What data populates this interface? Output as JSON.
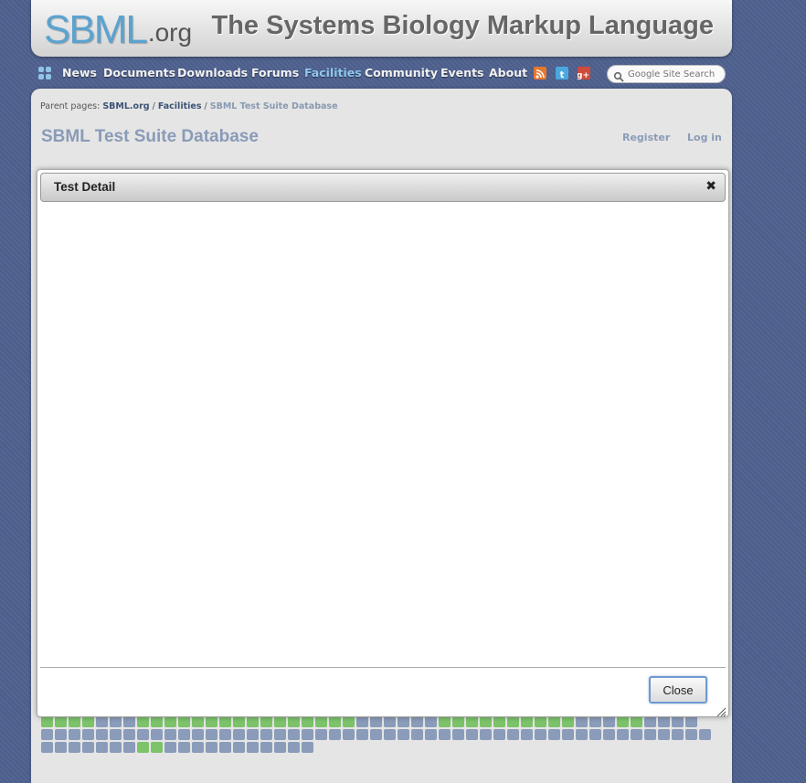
{
  "header": {
    "logo_mark": "SBML",
    "logo_suffix": ".org",
    "site_title": "The Systems Biology Markup Language"
  },
  "nav": {
    "home_icon": "sbml-home-icon",
    "items": [
      {
        "label": "News"
      },
      {
        "label": "Documents"
      },
      {
        "label": "Downloads"
      },
      {
        "label": "Forums"
      },
      {
        "label": "Facilities",
        "active": true
      },
      {
        "label": "Community"
      },
      {
        "label": "Events"
      },
      {
        "label": "About"
      }
    ],
    "social_icons": [
      "rss-icon",
      "twitter-icon",
      "google-plus-icon"
    ],
    "search": {
      "placeholder": "Google Site Search",
      "icon": "search-icon"
    }
  },
  "breadcrumb": {
    "prefix": "Parent pages:",
    "links": [
      "SBML.org",
      "Facilities"
    ],
    "current": "SBML Test Suite Database"
  },
  "page": {
    "title": "SBML Test Suite Database",
    "register_label": "Register",
    "login_label": "Log in"
  },
  "dialog": {
    "title": "Test Detail",
    "close_icon": "close-icon",
    "close_button_label": "Close",
    "resize_icon": "resize-grip-icon"
  },
  "result_grid": {
    "legend": {
      "pass": "green",
      "other": "gray"
    },
    "colors": {
      "pass": "#7cc36a",
      "other": "#8a9cba"
    },
    "rows": [
      "pppp444pppppppppppppppp888888pppppppppp333pp4444",
      "0000000000000000000000000000000000000000000000000",
      "0000000pp00000000000"
    ]
  },
  "colors": {
    "background": "#4d5f8c",
    "nav_active": "#8fc8ef",
    "title_color": "#8a9bb8",
    "rss": "#e8772e",
    "twitter": "#4aa8de",
    "google_plus": "#cf4a3a"
  }
}
